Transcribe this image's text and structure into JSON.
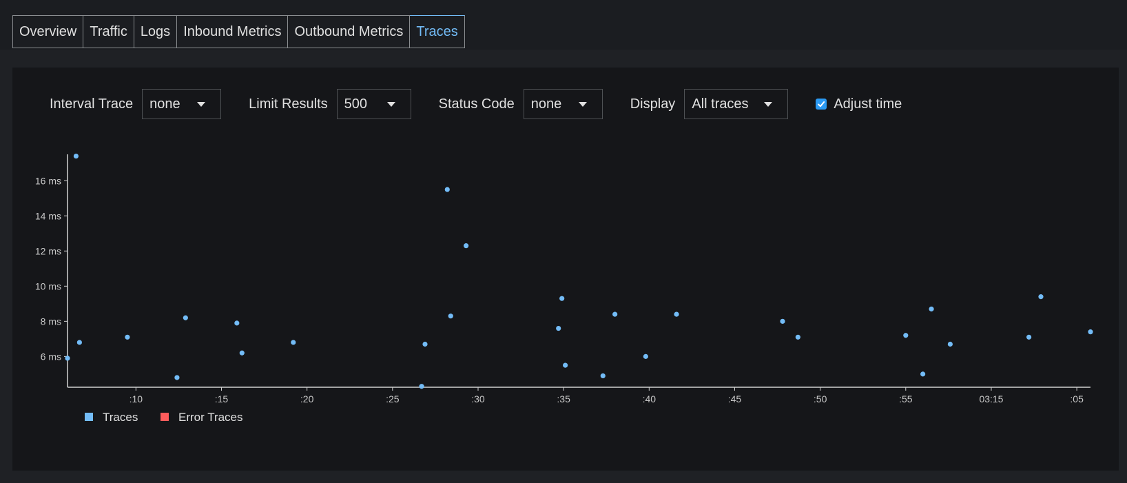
{
  "tabs": [
    {
      "label": "Overview"
    },
    {
      "label": "Traffic"
    },
    {
      "label": "Logs"
    },
    {
      "label": "Inbound Metrics"
    },
    {
      "label": "Outbound Metrics"
    },
    {
      "label": "Traces"
    }
  ],
  "active_tab": "Traces",
  "toolbar": {
    "interval_label": "Interval Trace",
    "interval_value": "none",
    "limit_label": "Limit Results",
    "limit_value": "500",
    "status_label": "Status Code",
    "status_value": "none",
    "display_label": "Display",
    "display_value": "All traces",
    "adjust_label": "Adjust time",
    "adjust_checked": true
  },
  "colors": {
    "accent": "#73bcf7",
    "trace_point": "#73bcf7",
    "error_trace": "#ff5c5c",
    "checkbox": "#2b9af3"
  },
  "chart_data": {
    "type": "scatter",
    "xlabel": "",
    "ylabel": "",
    "y_unit": "ms",
    "yticks": [
      "6 ms",
      "8 ms",
      "10 ms",
      "12 ms",
      "14 ms",
      "16 ms"
    ],
    "xticks": [
      ":10",
      ":15",
      ":20",
      ":25",
      ":30",
      ":35",
      ":40",
      ":45",
      ":50",
      ":55",
      "03:15",
      ":05"
    ],
    "xlim": [
      6,
      65.8
    ],
    "ylim": [
      4.25,
      17.5
    ],
    "legend": [
      {
        "name": "Traces",
        "color": "#73bcf7"
      },
      {
        "name": "Error Traces",
        "color": "#ff5c5c"
      }
    ],
    "series": [
      {
        "name": "Traces",
        "points": [
          [
            6.0,
            5.9
          ],
          [
            6.5,
            17.4
          ],
          [
            6.7,
            6.8
          ],
          [
            9.5,
            7.1
          ],
          [
            12.4,
            4.8
          ],
          [
            12.9,
            8.2
          ],
          [
            15.9,
            7.9
          ],
          [
            16.2,
            6.2
          ],
          [
            19.2,
            6.8
          ],
          [
            26.7,
            4.3
          ],
          [
            26.9,
            6.7
          ],
          [
            28.2,
            15.5
          ],
          [
            28.4,
            8.3
          ],
          [
            29.3,
            12.3
          ],
          [
            34.7,
            7.6
          ],
          [
            34.9,
            9.3
          ],
          [
            35.1,
            5.5
          ],
          [
            37.3,
            4.9
          ],
          [
            38.0,
            8.4
          ],
          [
            39.8,
            6.0
          ],
          [
            41.6,
            8.4
          ],
          [
            47.8,
            8.0
          ],
          [
            48.7,
            7.1
          ],
          [
            55.0,
            7.2
          ],
          [
            56.0,
            5.0
          ],
          [
            56.5,
            8.7
          ],
          [
            57.6,
            6.7
          ],
          [
            62.2,
            7.1
          ],
          [
            62.9,
            9.4
          ],
          [
            65.8,
            7.4
          ]
        ]
      }
    ]
  }
}
